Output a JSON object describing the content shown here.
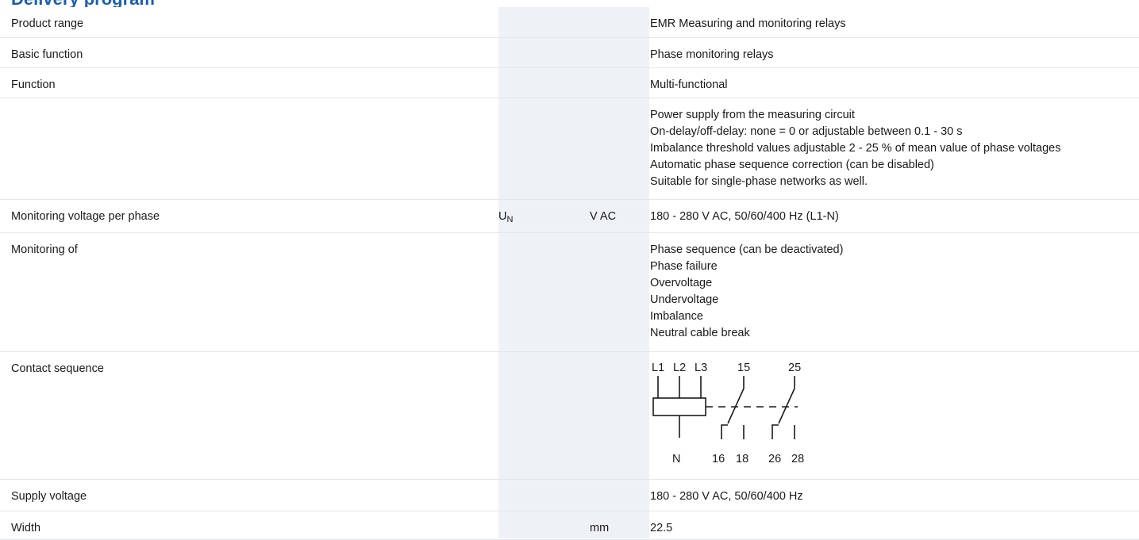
{
  "page": {
    "heading": "Delivery program"
  },
  "rows": [
    {
      "label": "Product range",
      "symbol": "",
      "unit": "",
      "values": [
        "EMR Measuring and monitoring relays"
      ]
    },
    {
      "label": "Basic function",
      "symbol": "",
      "unit": "",
      "values": [
        "Phase monitoring relays"
      ]
    },
    {
      "label": "Function",
      "symbol": "",
      "unit": "",
      "values": [
        "Multi-functional"
      ]
    },
    {
      "label": "",
      "symbol": "",
      "unit": "",
      "values": [
        "Power supply from the measuring circuit",
        "On-delay/off-delay: none = 0 or adjustable between 0.1 - 30 s",
        "Imbalance threshold values adjustable 2 - 25 % of mean value of phase voltages",
        "Automatic phase sequence correction (can be disabled)",
        "Suitable for single-phase networks as well."
      ]
    },
    {
      "label": "Monitoring voltage per phase",
      "symbol": "U",
      "symbol_sub": "N",
      "unit": "V AC",
      "values": [
        "180 - 280 V AC, 50/60/400 Hz (L1-N)"
      ]
    },
    {
      "label": "Monitoring of",
      "symbol": "",
      "unit": "",
      "values": [
        "Phase sequence (can be deactivated)",
        "Phase failure",
        "Overvoltage",
        "Undervoltage",
        "Imbalance",
        "Neutral cable break"
      ]
    },
    {
      "label": "Contact sequence",
      "symbol": "",
      "unit": "",
      "values": []
    },
    {
      "label": "Supply voltage",
      "symbol": "",
      "unit": "",
      "values": [
        "180 - 280 V AC, 50/60/400 Hz"
      ]
    },
    {
      "label": "Width",
      "symbol": "",
      "unit": "mm",
      "values": [
        "22.5"
      ]
    }
  ],
  "contact_diagram": {
    "top_labels": [
      "L1",
      "L2",
      "L3",
      "15",
      "25"
    ],
    "bottom_labels": [
      "N",
      "16",
      "18",
      "26",
      "28"
    ],
    "line_color": "#1a1a1a"
  },
  "colors": {
    "heading": "#1a5fb4",
    "shaded_column": "#eef1f5",
    "row_divider": "#e3e6eb"
  }
}
